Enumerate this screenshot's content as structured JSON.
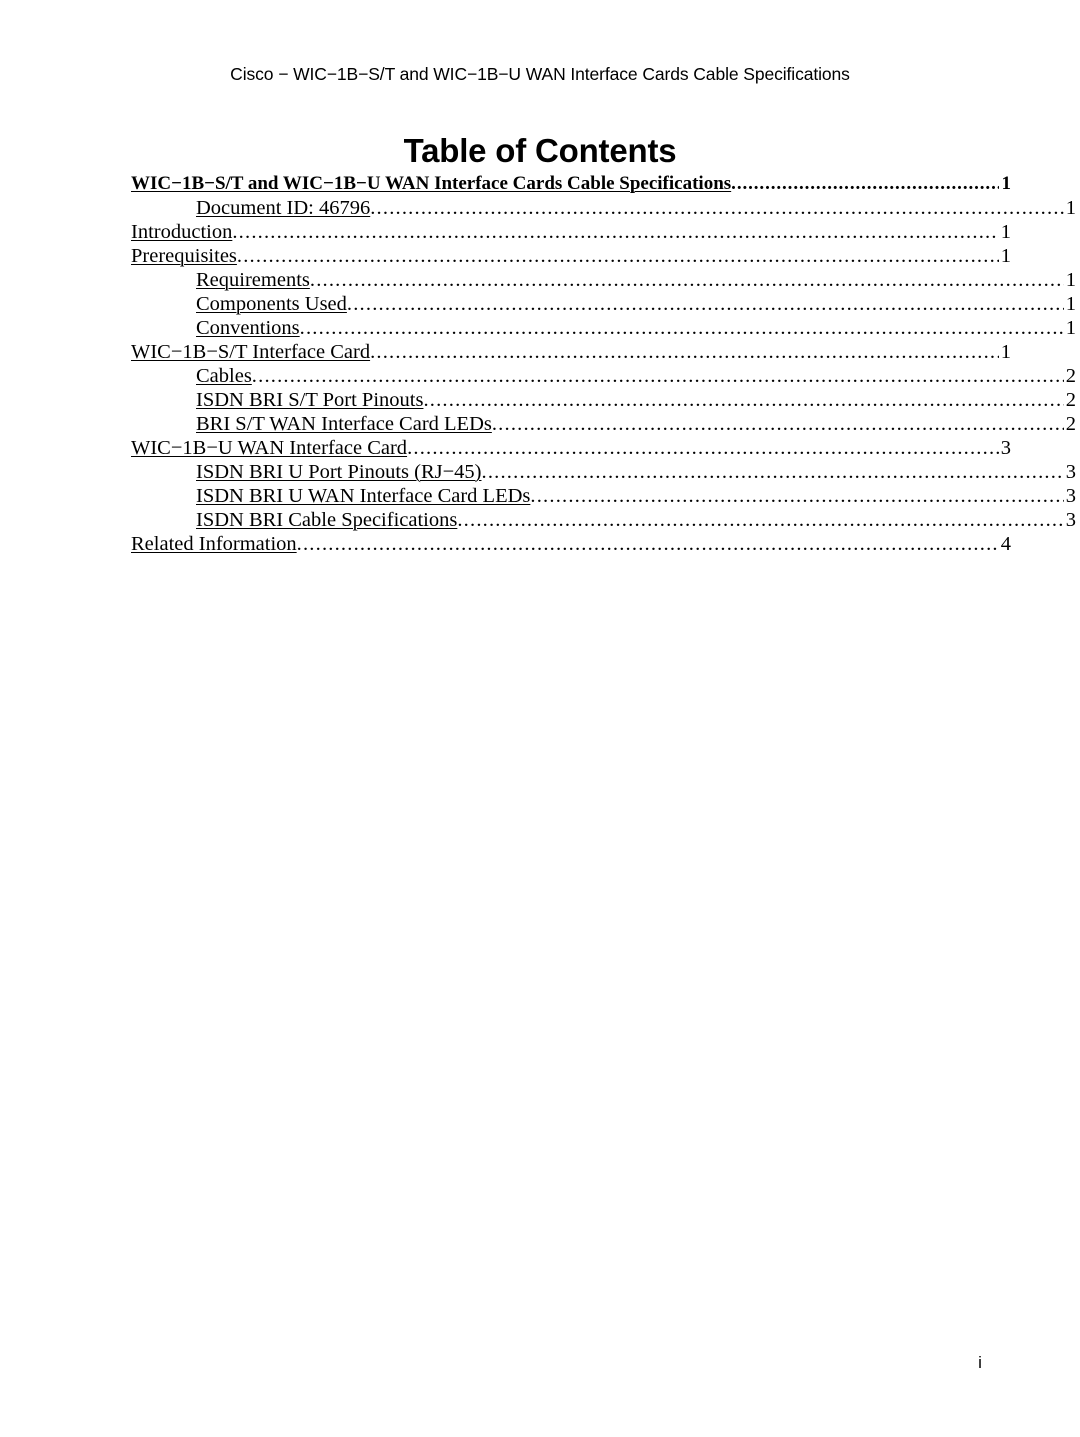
{
  "header": {
    "running_head": "Cisco − WIC−1B−S/T and WIC−1B−U WAN Interface Cards Cable Specifications"
  },
  "title": "Table of Contents",
  "toc": {
    "entries": [
      {
        "label": "WIC−1B−S/T and WIC−1B−U WAN Interface Cards Cable Specifications",
        "page": "1",
        "level": 0,
        "bold": true
      },
      {
        "label": "Document ID: 46796",
        "page": "1",
        "level": 2,
        "bold": false
      },
      {
        "label": " Introduction",
        "page": "1",
        "level": 0,
        "bold": false
      },
      {
        "label": " Prerequisites",
        "page": "1",
        "level": 0,
        "bold": false
      },
      {
        "label": " Requirements",
        "page": "1",
        "level": 1,
        "bold": false
      },
      {
        "label": " Components Used",
        "page": "1",
        "level": 1,
        "bold": false
      },
      {
        "label": " Conventions",
        "page": "1",
        "level": 1,
        "bold": false
      },
      {
        "label": " WIC−1B−S/T Interface Card",
        "page": "1",
        "level": 0,
        "bold": false
      },
      {
        "label": " Cables",
        "page": "2",
        "level": 1,
        "bold": false
      },
      {
        "label": " ISDN BRI S/T Port Pinouts",
        "page": "2",
        "level": 1,
        "bold": false
      },
      {
        "label": " BRI S/T WAN Interface Card LEDs",
        "page": "2",
        "level": 1,
        "bold": false
      },
      {
        "label": " WIC−1B−U WAN Interface Card",
        "page": "3",
        "level": 0,
        "bold": false
      },
      {
        "label": " ISDN BRI U Port Pinouts (RJ−45)",
        "page": "3",
        "level": 1,
        "bold": false
      },
      {
        "label": " ISDN BRI U WAN Interface Card LEDs",
        "page": "3",
        "level": 1,
        "bold": false
      },
      {
        "label": " ISDN BRI Cable Specifications",
        "page": "3",
        "level": 1,
        "bold": false
      },
      {
        "label": " Related Information",
        "page": "4",
        "level": 0,
        "bold": false
      }
    ]
  },
  "footer": {
    "page_number": "i"
  }
}
